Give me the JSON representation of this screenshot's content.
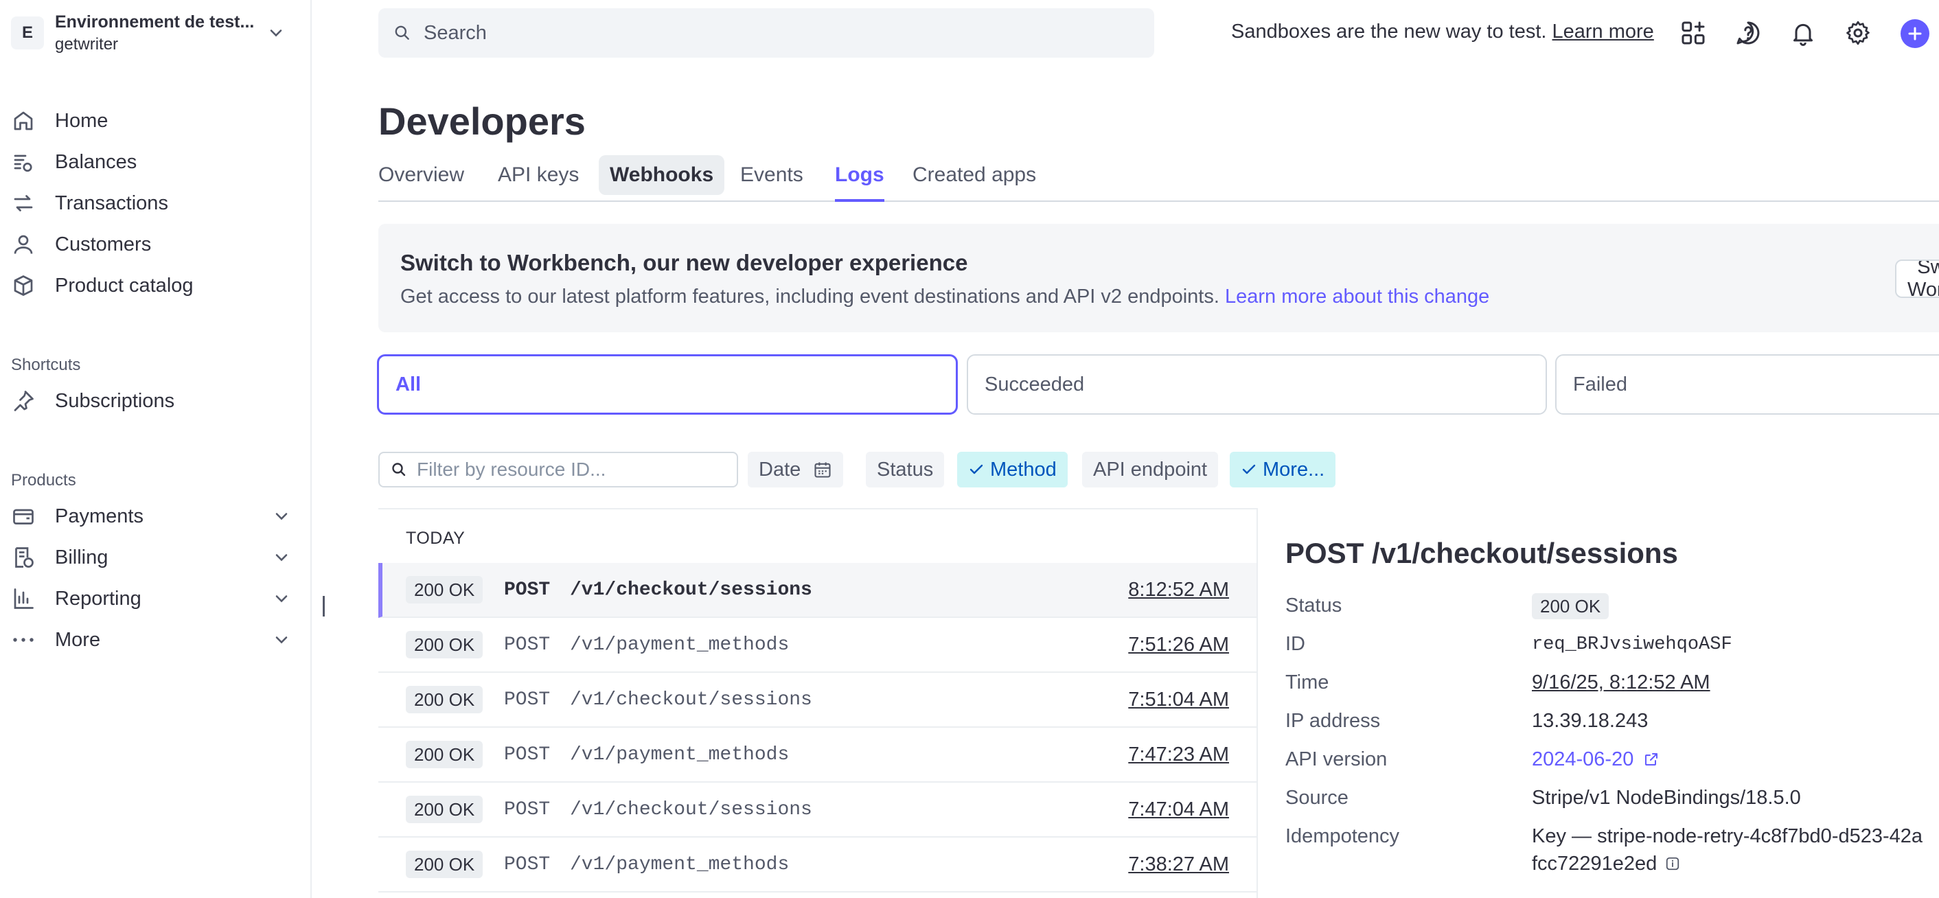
{
  "account": {
    "initial": "E",
    "name": "Environnement de test...",
    "sub": "getwriter"
  },
  "sidebar": {
    "main": [
      {
        "label": "Home",
        "icon": "home-icon"
      },
      {
        "label": "Balances",
        "icon": "balances-icon"
      },
      {
        "label": "Transactions",
        "icon": "transactions-icon"
      },
      {
        "label": "Customers",
        "icon": "customers-icon"
      },
      {
        "label": "Product catalog",
        "icon": "product-catalog-icon"
      }
    ],
    "shortcuts_title": "Shortcuts",
    "shortcuts": [
      {
        "label": "Subscriptions",
        "icon": "pin-icon"
      }
    ],
    "products_title": "Products",
    "products": [
      {
        "label": "Payments",
        "icon": "payments-icon"
      },
      {
        "label": "Billing",
        "icon": "billing-icon"
      },
      {
        "label": "Reporting",
        "icon": "reporting-icon"
      },
      {
        "label": "More",
        "icon": "more-icon"
      }
    ]
  },
  "topbar": {
    "search_placeholder": "Search",
    "sandbox_note": "Sandboxes are the new way to test.",
    "learn_more": "Learn more"
  },
  "page": {
    "title": "Developers",
    "tabs": [
      "Overview",
      "API keys",
      "Webhooks",
      "Events",
      "Logs",
      "Created apps"
    ],
    "active_tab": "Logs"
  },
  "banner": {
    "title": "Switch to Workbench, our new developer experience",
    "text": "Get access to our latest platform features, including event destinations and API v2 endpoints.",
    "link": "Learn more about this change",
    "button": "Switch to Workbench"
  },
  "segments": [
    "All",
    "Succeeded",
    "Failed"
  ],
  "filters": {
    "placeholder": "Filter by resource ID...",
    "chips": [
      "Date",
      "Status",
      "Method",
      "API endpoint",
      "More..."
    ]
  },
  "logs": {
    "group": "TODAY",
    "rows": [
      {
        "status": "200 OK",
        "method": "POST",
        "path": "/v1/checkout/sessions",
        "time": "8:12:52 AM"
      },
      {
        "status": "200 OK",
        "method": "POST",
        "path": "/v1/payment_methods",
        "time": "7:51:26 AM"
      },
      {
        "status": "200 OK",
        "method": "POST",
        "path": "/v1/checkout/sessions",
        "time": "7:51:04 AM"
      },
      {
        "status": "200 OK",
        "method": "POST",
        "path": "/v1/payment_methods",
        "time": "7:47:23 AM"
      },
      {
        "status": "200 OK",
        "method": "POST",
        "path": "/v1/checkout/sessions",
        "time": "7:47:04 AM"
      },
      {
        "status": "200 OK",
        "method": "POST",
        "path": "/v1/payment_methods",
        "time": "7:38:27 AM"
      }
    ]
  },
  "detail": {
    "title": "POST /v1/checkout/sessions",
    "labels": {
      "status": "Status",
      "id": "ID",
      "time": "Time",
      "ip": "IP address",
      "api_version": "API version",
      "source": "Source",
      "idempotency": "Idempotency"
    },
    "values": {
      "status": "200 OK",
      "id": "req_BRJvsiwehqoASF",
      "time": "9/16/25, 8:12:52 AM",
      "ip": "13.39.18.243",
      "api_version": "2024-06-20",
      "source": "Stripe/v1 NodeBindings/18.5.0",
      "idempotency_line1": "Key — stripe-node-retry-4c8f7bd0-d523-42a",
      "idempotency_line2": "fcc72291e2ed"
    }
  },
  "colors": {
    "accent": "#635bff",
    "text": "#30313d",
    "muted": "#545969",
    "chip_on": "#cff5f6"
  }
}
